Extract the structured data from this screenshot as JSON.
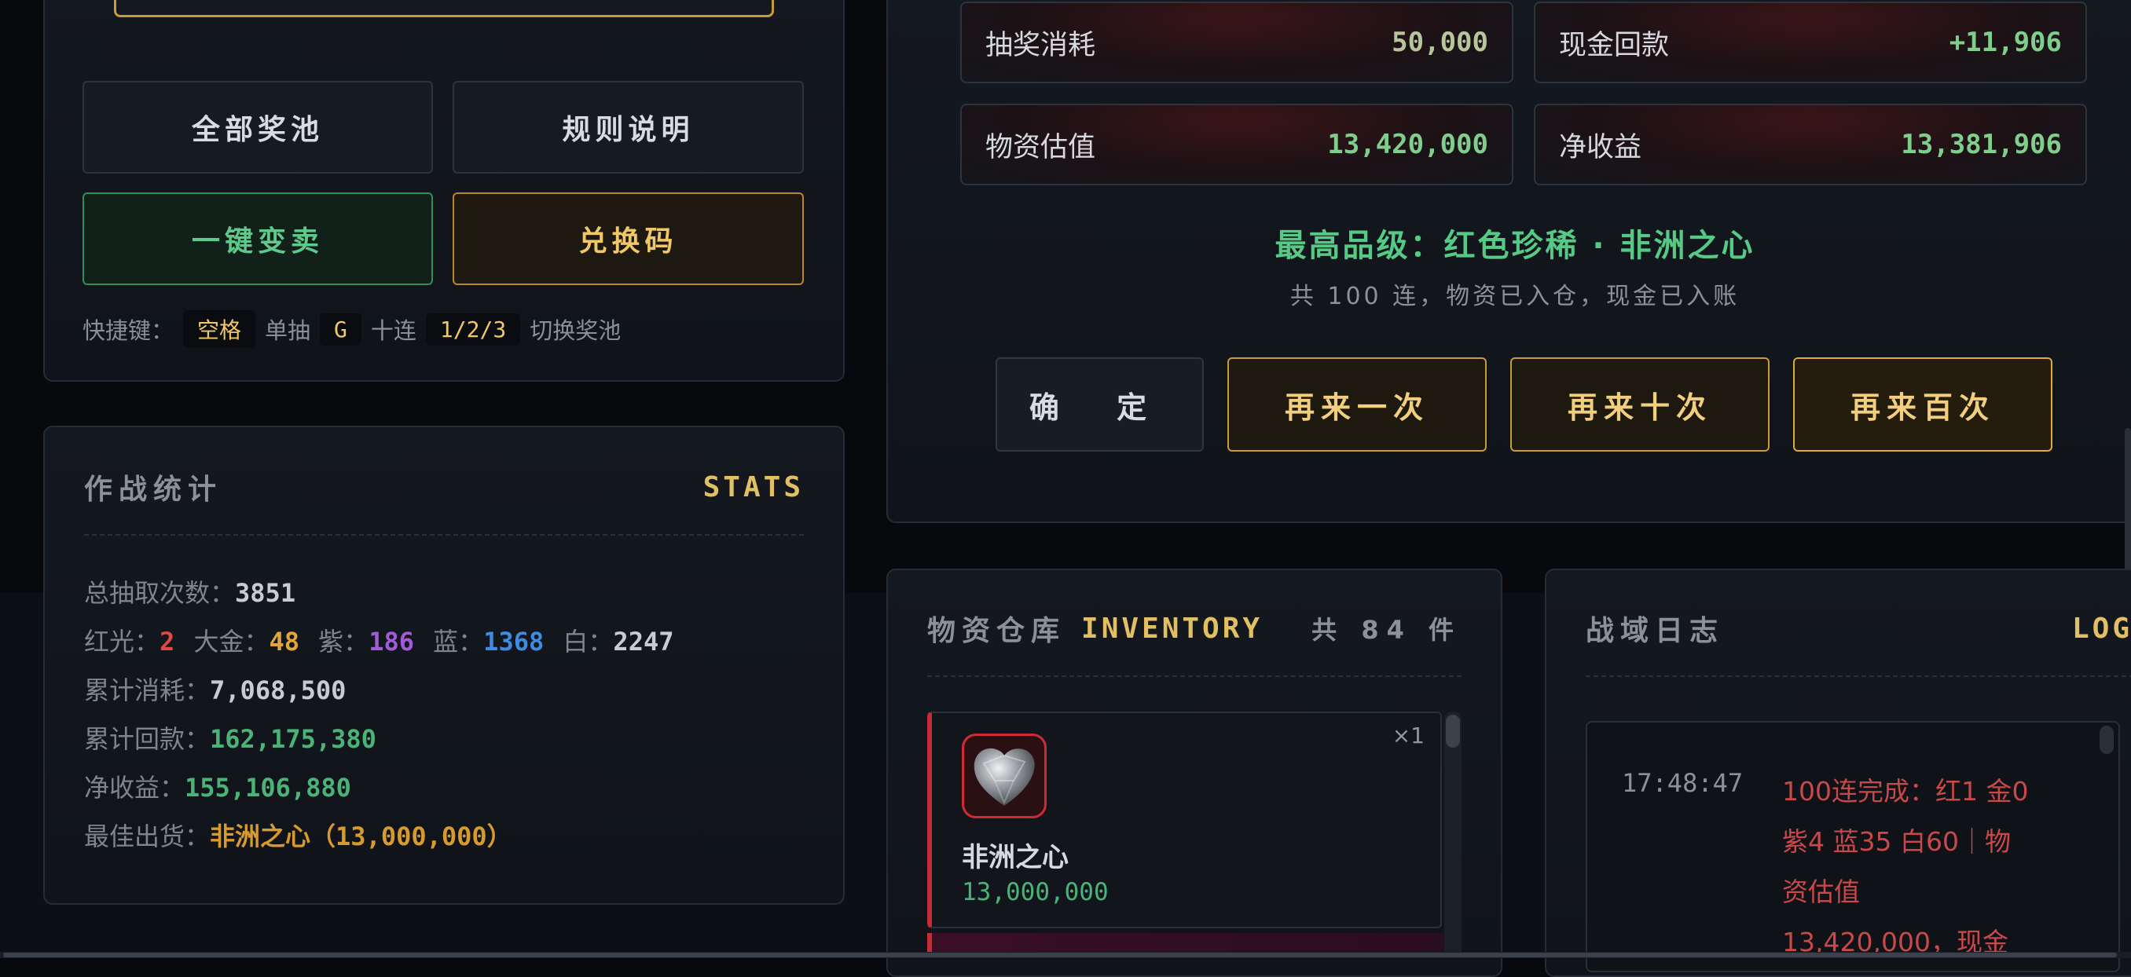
{
  "pool_buttons": {
    "all_pools": "全部奖池",
    "rules": "规则说明",
    "sell_all": "一键变卖",
    "redeem_code": "兑换码"
  },
  "shortcuts": {
    "prefix": "快捷键：",
    "key_space": "空格",
    "single_label": "单抽",
    "key_g": "G",
    "ten_label": "十连",
    "key_pools": "1/2/3",
    "switch_label": "切换奖池"
  },
  "stats": {
    "title": "作战统计",
    "tag": "STATS",
    "total_label": "总抽取次数：",
    "total_value": "3851",
    "red_label": "红光：",
    "red_value": "2",
    "gold_label": "大金：",
    "gold_value": "48",
    "purple_label": "紫：",
    "purple_value": "186",
    "blue_label": "蓝：",
    "blue_value": "1368",
    "white_label": "白：",
    "white_value": "2247",
    "cost_label": "累计消耗：",
    "cost_value": "7,068,500",
    "return_label": "累计回款：",
    "return_value": "162,175,380",
    "net_label": "净收益：",
    "net_value": "155,106,880",
    "best_label": "最佳出货：",
    "best_value": "非洲之心（13,000,000）"
  },
  "summary": {
    "cost_label": "抽奖消耗",
    "cost_value": "50,000",
    "cash_label": "现金回款",
    "cash_value": "+11,906",
    "goods_label": "物资估值",
    "goods_value": "13,420,000",
    "net_label": "净收益",
    "net_value": "13,381,906",
    "highest": "最高品级：红色珍稀 · 非洲之心",
    "sub": "共 100 连，物资已入仓，现金已入账",
    "confirm": "确 定",
    "again_one": "再来一次",
    "again_ten": "再来十次",
    "again_hundred": "再来百次"
  },
  "inventory": {
    "title": "物资仓库",
    "tag": "INVENTORY",
    "count": "共 84 件",
    "item_name": "非洲之心",
    "item_value": "13,000,000",
    "item_qty": "×1"
  },
  "log": {
    "title": "战域日志",
    "tag": "LOG",
    "time": "17:48:47",
    "line1": "100连完成：红1 金0",
    "line2": "紫4 蓝35 白60｜物",
    "line3": "资估值",
    "line4": "13,420,000，现金"
  },
  "colors": {
    "accent_gold": "#e1bf63",
    "accent_green": "#56c985",
    "rarity_red": "#e04848"
  }
}
